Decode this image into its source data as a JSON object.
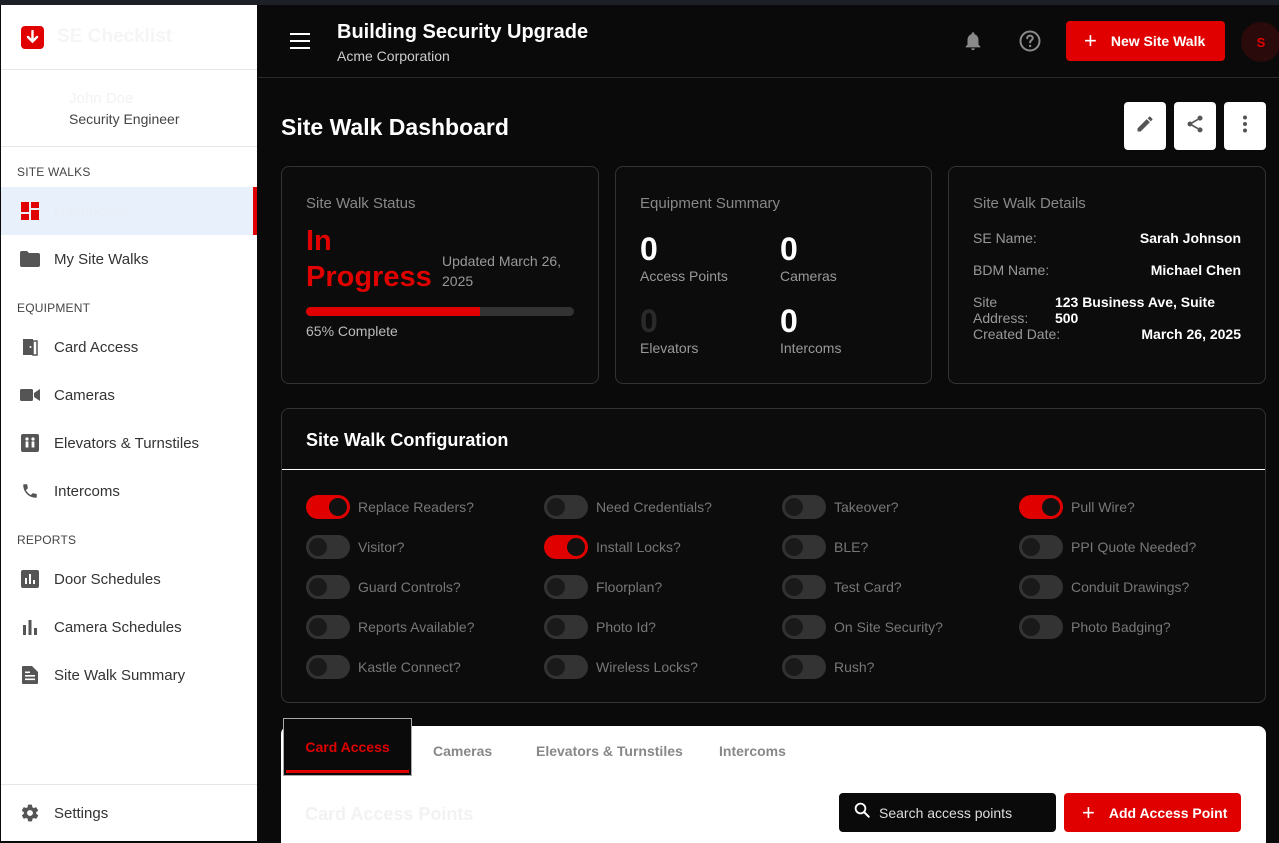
{
  "app": {
    "brand": "SE Checklist"
  },
  "user": {
    "name": "John Doe",
    "role": "Security Engineer"
  },
  "sidebar": {
    "sections": [
      {
        "heading": "SITE WALKS",
        "items": [
          {
            "label": "Dashboard",
            "icon": "dashboard-icon",
            "active": true
          },
          {
            "label": "My Site Walks",
            "icon": "folder-icon"
          }
        ]
      },
      {
        "heading": "EQUIPMENT",
        "items": [
          {
            "label": "Card Access",
            "icon": "door-icon"
          },
          {
            "label": "Cameras",
            "icon": "camera-icon"
          },
          {
            "label": "Elevators & Turnstiles",
            "icon": "elevator-icon"
          },
          {
            "label": "Intercoms",
            "icon": "phone-icon"
          }
        ]
      },
      {
        "heading": "REPORTS",
        "items": [
          {
            "label": "Door Schedules",
            "icon": "bar-chart-icon"
          },
          {
            "label": "Camera Schedules",
            "icon": "bar-chart-icon"
          },
          {
            "label": "Site Walk Summary",
            "icon": "document-icon"
          }
        ]
      }
    ],
    "settings_label": "Settings"
  },
  "header": {
    "project_title": "Building Security Upgrade",
    "project_subtitle": "Acme Corporation",
    "new_button": "New Site Walk",
    "avatar_initial": "S"
  },
  "dashboard": {
    "title": "Site Walk Dashboard",
    "status": {
      "title": "Site Walk Status",
      "value_line1": "In",
      "value_line2": "Progress",
      "updated_line1": "Updated March 26,",
      "updated_line2": "2025",
      "progress_percent": 65,
      "progress_text": "65% Complete"
    },
    "equipment": {
      "title": "Equipment Summary",
      "access_points": {
        "value": "0",
        "label": "Access Points"
      },
      "cameras": {
        "value": "0",
        "label": "Cameras"
      },
      "elevators": {
        "value": "0",
        "label": "Elevators"
      },
      "intercoms": {
        "value": "0",
        "label": "Intercoms"
      }
    },
    "details": {
      "title": "Site Walk Details",
      "rows": [
        {
          "key": "SE Name:",
          "value": "Sarah Johnson"
        },
        {
          "key": "BDM Name:",
          "value": "Michael Chen"
        },
        {
          "key": "Site Address:",
          "value": "123 Business Ave, Suite 500"
        },
        {
          "key": "Created Date:",
          "value": "March 26, 2025"
        }
      ]
    }
  },
  "config": {
    "title": "Site Walk Configuration",
    "columns": [
      [
        {
          "label": "Replace Readers?",
          "on": true
        },
        {
          "label": "Visitor?",
          "on": false
        },
        {
          "label": "Guard Controls?",
          "on": false
        },
        {
          "label": "Reports Available?",
          "on": false
        },
        {
          "label": "Kastle Connect?",
          "on": false
        }
      ],
      [
        {
          "label": "Need Credentials?",
          "on": false
        },
        {
          "label": "Install Locks?",
          "on": true
        },
        {
          "label": "Floorplan?",
          "on": false
        },
        {
          "label": "Photo Id?",
          "on": false
        },
        {
          "label": "Wireless Locks?",
          "on": false
        }
      ],
      [
        {
          "label": "Takeover?",
          "on": false
        },
        {
          "label": "BLE?",
          "on": false
        },
        {
          "label": "Test Card?",
          "on": false
        },
        {
          "label": "On Site Security?",
          "on": false
        },
        {
          "label": "Rush?",
          "on": false
        }
      ],
      [
        {
          "label": "Pull Wire?",
          "on": true
        },
        {
          "label": "PPI Quote Needed?",
          "on": false
        },
        {
          "label": "Conduit Drawings?",
          "on": false
        },
        {
          "label": "Photo Badging?",
          "on": false
        }
      ]
    ]
  },
  "tabs": {
    "items": [
      "Card Access",
      "Cameras",
      "Elevators & Turnstiles",
      "Intercoms"
    ],
    "active": 0,
    "pane_title": "Card Access Points",
    "search_placeholder": "Search access points",
    "add_button": "Add Access Point"
  },
  "colors": {
    "accent": "#e00000",
    "background": "#0a0a0a",
    "sidebar": "#ffffff"
  }
}
